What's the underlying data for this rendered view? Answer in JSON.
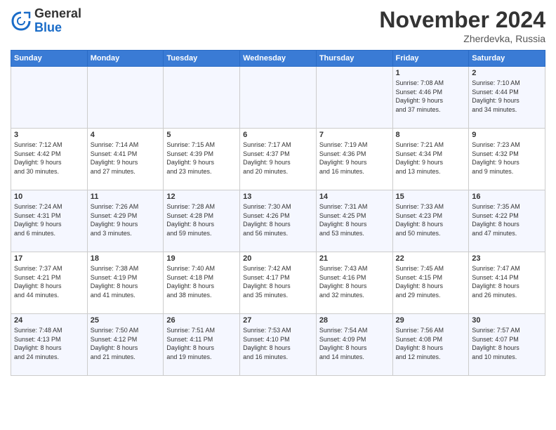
{
  "logo": {
    "general": "General",
    "blue": "Blue"
  },
  "title": "November 2024",
  "location": "Zherdevka, Russia",
  "weekdays": [
    "Sunday",
    "Monday",
    "Tuesday",
    "Wednesday",
    "Thursday",
    "Friday",
    "Saturday"
  ],
  "weeks": [
    [
      {
        "day": "",
        "info": ""
      },
      {
        "day": "",
        "info": ""
      },
      {
        "day": "",
        "info": ""
      },
      {
        "day": "",
        "info": ""
      },
      {
        "day": "",
        "info": ""
      },
      {
        "day": "1",
        "info": "Sunrise: 7:08 AM\nSunset: 4:46 PM\nDaylight: 9 hours\nand 37 minutes."
      },
      {
        "day": "2",
        "info": "Sunrise: 7:10 AM\nSunset: 4:44 PM\nDaylight: 9 hours\nand 34 minutes."
      }
    ],
    [
      {
        "day": "3",
        "info": "Sunrise: 7:12 AM\nSunset: 4:42 PM\nDaylight: 9 hours\nand 30 minutes."
      },
      {
        "day": "4",
        "info": "Sunrise: 7:14 AM\nSunset: 4:41 PM\nDaylight: 9 hours\nand 27 minutes."
      },
      {
        "day": "5",
        "info": "Sunrise: 7:15 AM\nSunset: 4:39 PM\nDaylight: 9 hours\nand 23 minutes."
      },
      {
        "day": "6",
        "info": "Sunrise: 7:17 AM\nSunset: 4:37 PM\nDaylight: 9 hours\nand 20 minutes."
      },
      {
        "day": "7",
        "info": "Sunrise: 7:19 AM\nSunset: 4:36 PM\nDaylight: 9 hours\nand 16 minutes."
      },
      {
        "day": "8",
        "info": "Sunrise: 7:21 AM\nSunset: 4:34 PM\nDaylight: 9 hours\nand 13 minutes."
      },
      {
        "day": "9",
        "info": "Sunrise: 7:23 AM\nSunset: 4:32 PM\nDaylight: 9 hours\nand 9 minutes."
      }
    ],
    [
      {
        "day": "10",
        "info": "Sunrise: 7:24 AM\nSunset: 4:31 PM\nDaylight: 9 hours\nand 6 minutes."
      },
      {
        "day": "11",
        "info": "Sunrise: 7:26 AM\nSunset: 4:29 PM\nDaylight: 9 hours\nand 3 minutes."
      },
      {
        "day": "12",
        "info": "Sunrise: 7:28 AM\nSunset: 4:28 PM\nDaylight: 8 hours\nand 59 minutes."
      },
      {
        "day": "13",
        "info": "Sunrise: 7:30 AM\nSunset: 4:26 PM\nDaylight: 8 hours\nand 56 minutes."
      },
      {
        "day": "14",
        "info": "Sunrise: 7:31 AM\nSunset: 4:25 PM\nDaylight: 8 hours\nand 53 minutes."
      },
      {
        "day": "15",
        "info": "Sunrise: 7:33 AM\nSunset: 4:23 PM\nDaylight: 8 hours\nand 50 minutes."
      },
      {
        "day": "16",
        "info": "Sunrise: 7:35 AM\nSunset: 4:22 PM\nDaylight: 8 hours\nand 47 minutes."
      }
    ],
    [
      {
        "day": "17",
        "info": "Sunrise: 7:37 AM\nSunset: 4:21 PM\nDaylight: 8 hours\nand 44 minutes."
      },
      {
        "day": "18",
        "info": "Sunrise: 7:38 AM\nSunset: 4:19 PM\nDaylight: 8 hours\nand 41 minutes."
      },
      {
        "day": "19",
        "info": "Sunrise: 7:40 AM\nSunset: 4:18 PM\nDaylight: 8 hours\nand 38 minutes."
      },
      {
        "day": "20",
        "info": "Sunrise: 7:42 AM\nSunset: 4:17 PM\nDaylight: 8 hours\nand 35 minutes."
      },
      {
        "day": "21",
        "info": "Sunrise: 7:43 AM\nSunset: 4:16 PM\nDaylight: 8 hours\nand 32 minutes."
      },
      {
        "day": "22",
        "info": "Sunrise: 7:45 AM\nSunset: 4:15 PM\nDaylight: 8 hours\nand 29 minutes."
      },
      {
        "day": "23",
        "info": "Sunrise: 7:47 AM\nSunset: 4:14 PM\nDaylight: 8 hours\nand 26 minutes."
      }
    ],
    [
      {
        "day": "24",
        "info": "Sunrise: 7:48 AM\nSunset: 4:13 PM\nDaylight: 8 hours\nand 24 minutes."
      },
      {
        "day": "25",
        "info": "Sunrise: 7:50 AM\nSunset: 4:12 PM\nDaylight: 8 hours\nand 21 minutes."
      },
      {
        "day": "26",
        "info": "Sunrise: 7:51 AM\nSunset: 4:11 PM\nDaylight: 8 hours\nand 19 minutes."
      },
      {
        "day": "27",
        "info": "Sunrise: 7:53 AM\nSunset: 4:10 PM\nDaylight: 8 hours\nand 16 minutes."
      },
      {
        "day": "28",
        "info": "Sunrise: 7:54 AM\nSunset: 4:09 PM\nDaylight: 8 hours\nand 14 minutes."
      },
      {
        "day": "29",
        "info": "Sunrise: 7:56 AM\nSunset: 4:08 PM\nDaylight: 8 hours\nand 12 minutes."
      },
      {
        "day": "30",
        "info": "Sunrise: 7:57 AM\nSunset: 4:07 PM\nDaylight: 8 hours\nand 10 minutes."
      }
    ]
  ]
}
